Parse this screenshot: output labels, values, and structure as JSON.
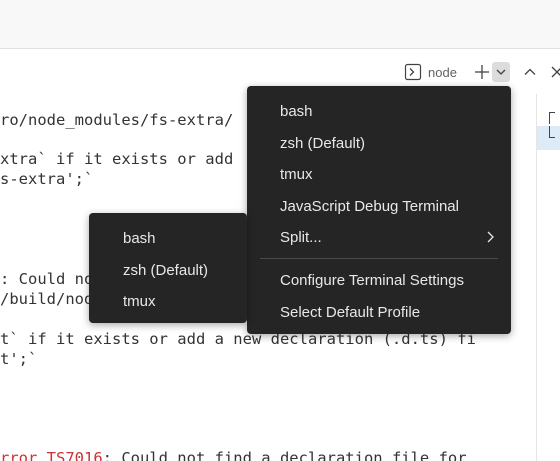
{
  "toolbar": {
    "terminal_name": "node",
    "terminal_icon": "terminal-icon",
    "new_terminal_icon": "plus-icon",
    "launch_profile_icon": "chevron-down-icon",
    "maximize_icon": "chevron-up-icon",
    "close_icon": "close-icon"
  },
  "terminal": {
    "lines": [
      "ro/node_modules/fs-extra/",
      "xtra` if it exists or add",
      "s-extra';`",
      ": Could no",
      "/build/nod",
      "t` if it exists or add a new declaration (.d.ts) fi",
      "t';`",
      "rror TS7016: Could not find a declaration file for"
    ]
  },
  "launch_menu": {
    "items": [
      "bash",
      "zsh (Default)",
      "tmux",
      "JavaScript Debug Terminal",
      "Split...",
      "Configure Terminal Settings",
      "Select Default Profile"
    ]
  },
  "split_submenu": {
    "items": [
      "bash",
      "zsh (Default)",
      "tmux"
    ]
  },
  "colors": {
    "menu_background": "#252526",
    "menu_text": "#e8e8e8",
    "error_red": "#cd3131",
    "active_tab": "#dcebf7"
  }
}
